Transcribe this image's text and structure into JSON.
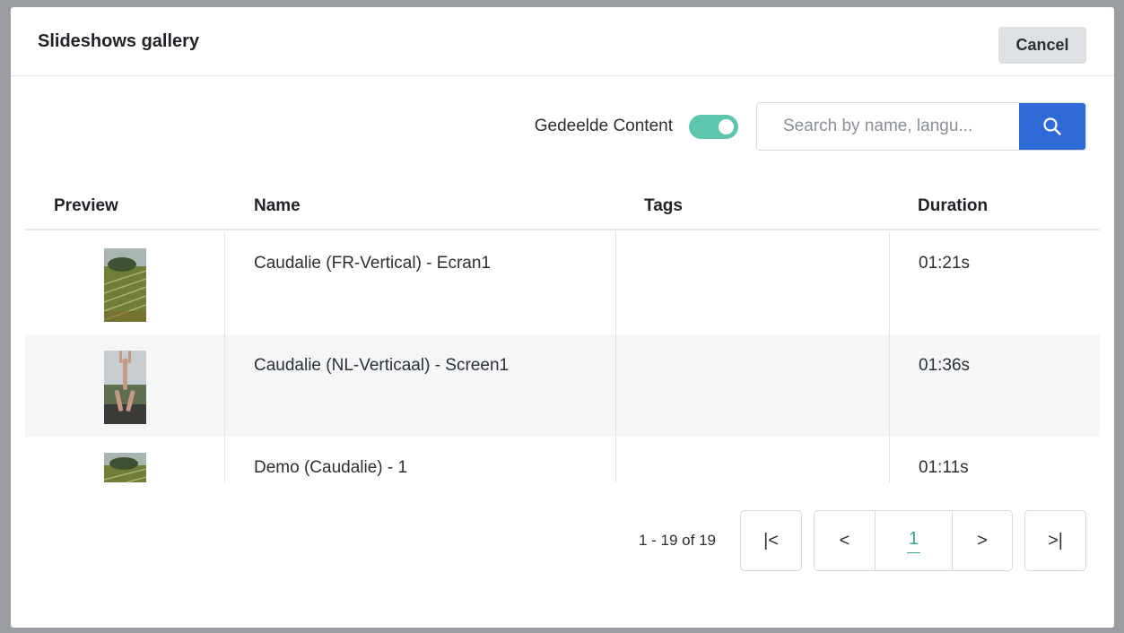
{
  "modal": {
    "title": "Slideshows gallery",
    "cancel_label": "Cancel"
  },
  "toolbar": {
    "toggle_label": "Gedeelde Content",
    "toggle_on": true,
    "search_placeholder": "Search by name, langu...",
    "search_value": ""
  },
  "table": {
    "columns": [
      "Preview",
      "Name",
      "Tags",
      "Duration"
    ],
    "rows": [
      {
        "name": "Caudalie (FR-Vertical) - Ecran1",
        "tags": "",
        "duration": "01:21s"
      },
      {
        "name": "Caudalie (NL-Verticaal) - Screen1",
        "tags": "",
        "duration": "01:36s"
      },
      {
        "name": "Demo (Caudalie) - 1",
        "tags": "",
        "duration": "01:11s"
      }
    ]
  },
  "pagination": {
    "range": "1 - 19 of 19",
    "current_page": "1",
    "first_label": "|<",
    "prev_label": "<",
    "next_label": ">",
    "last_label": ">|"
  },
  "colors": {
    "toggle_on": "#5fc6ad",
    "search_button": "#2e6bd6",
    "active_page": "#3aa887"
  }
}
